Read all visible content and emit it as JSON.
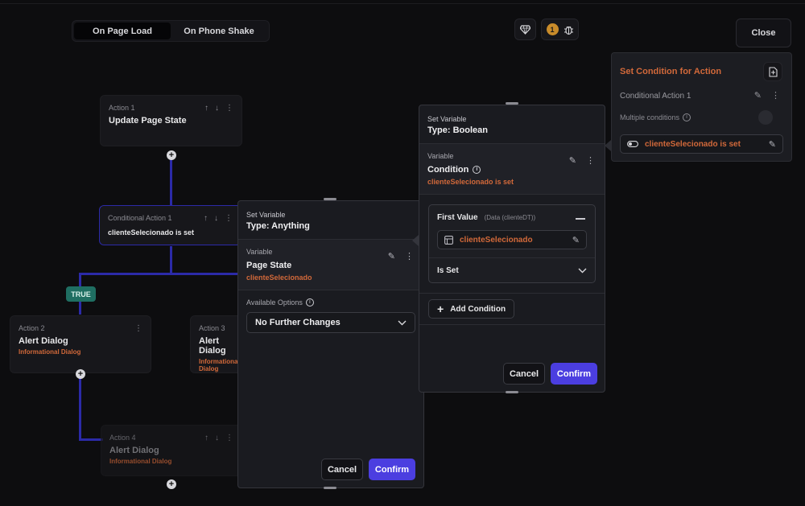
{
  "tabs": [
    {
      "label": "On Page Load",
      "active": true
    },
    {
      "label": "On Phone Shake",
      "active": false
    }
  ],
  "toolbar": {
    "debug_count": "1",
    "close_label": "Close"
  },
  "canvas": {
    "action1": {
      "label": "Action 1",
      "title": "Update Page State"
    },
    "conditional1": {
      "label": "Conditional Action 1",
      "condition": "clienteSelecionado is set"
    },
    "true_tag": "TRUE",
    "action2": {
      "label": "Action 2",
      "title": "Alert Dialog",
      "sub": "Informational Dialog"
    },
    "action3": {
      "label": "Action 3",
      "title": "Alert Dialog",
      "sub": "Informational Dialog"
    },
    "action4": {
      "label": "Action 4",
      "title": "Alert Dialog",
      "sub": "Informational Dialog"
    }
  },
  "set_var_panel": {
    "small": "Set Variable",
    "type": "Type: Anything",
    "var_label": "Variable",
    "var_title": "Page State",
    "var_value": "clienteSelecionado",
    "options_label": "Available Options",
    "selected_option": "No Further Changes",
    "cancel": "Cancel",
    "confirm": "Confirm"
  },
  "bool_panel": {
    "small": "Set Variable",
    "type": "Type: Boolean",
    "var_label": "Variable",
    "var_title": "Condition",
    "var_value": "clienteSelecionado is set",
    "first_value_label": "First Value",
    "first_value_hint": "(Data (clienteDT))",
    "first_value_chip": "clienteSelecionado",
    "operator": "Is Set",
    "add_condition": "Add Condition",
    "cancel": "Cancel",
    "confirm": "Confirm"
  },
  "cond_panel": {
    "title": "Set Condition for Action",
    "action_name": "Conditional Action 1",
    "multiple_label": "Multiple conditions",
    "condition_chip": "clienteSelecionado is set"
  },
  "colors": {
    "accent": "#4b3ee0",
    "orange": "#d2693a",
    "wire": "#2b2aa8",
    "true_tag": "#1f6e62"
  }
}
